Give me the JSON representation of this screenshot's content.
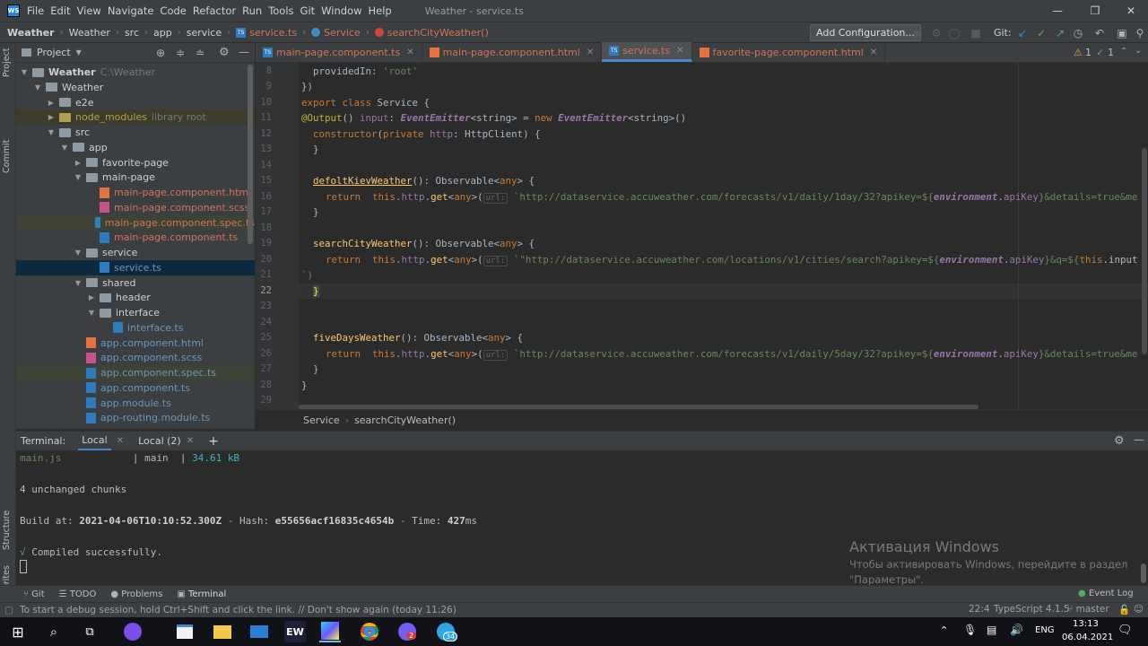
{
  "menu": [
    "File",
    "Edit",
    "View",
    "Navigate",
    "Code",
    "Refactor",
    "Run",
    "Tools",
    "Git",
    "Window",
    "Help"
  ],
  "window_title": "Weather - service.ts",
  "breadcrumb": [
    "Weather",
    "Weather",
    "src",
    "app",
    "service",
    "service.ts",
    "Service",
    "searchCityWeather()"
  ],
  "add_config": "Add Configuration...",
  "git_label": "Git:",
  "project_panel": {
    "title": "Project",
    "tree": [
      {
        "label": "Weather",
        "extra": "C:\\Weather",
        "depth": 0,
        "arrow": "v",
        "type": "folder"
      },
      {
        "label": "Weather",
        "extra": "",
        "depth": 1,
        "arrow": "v",
        "type": "folder"
      },
      {
        "label": "e2e",
        "extra": "",
        "depth": 2,
        "arrow": ">",
        "type": "folder"
      },
      {
        "label": "node_modules",
        "extra": "library root",
        "depth": 2,
        "arrow": ">",
        "type": "folder-yellow"
      },
      {
        "label": "src",
        "extra": "",
        "depth": 2,
        "arrow": "v",
        "type": "folder"
      },
      {
        "label": "app",
        "extra": "",
        "depth": 3,
        "arrow": "v",
        "type": "folder"
      },
      {
        "label": "favorite-page",
        "extra": "",
        "depth": 4,
        "arrow": ">",
        "type": "folder"
      },
      {
        "label": "main-page",
        "extra": "",
        "depth": 4,
        "arrow": "v",
        "type": "folder"
      },
      {
        "label": "main-page.component.html",
        "extra": "",
        "depth": 5,
        "arrow": "",
        "type": "html"
      },
      {
        "label": "main-page.component.scss",
        "extra": "",
        "depth": 5,
        "arrow": "",
        "type": "scss"
      },
      {
        "label": "main-page.component.spec.ts",
        "extra": "",
        "depth": 5,
        "arrow": "",
        "type": "ts"
      },
      {
        "label": "main-page.component.ts",
        "extra": "",
        "depth": 5,
        "arrow": "",
        "type": "ts"
      },
      {
        "label": "service",
        "extra": "",
        "depth": 4,
        "arrow": "v",
        "type": "folder"
      },
      {
        "label": "service.ts",
        "extra": "",
        "depth": 5,
        "arrow": "",
        "type": "ts"
      },
      {
        "label": "shared",
        "extra": "",
        "depth": 4,
        "arrow": "v",
        "type": "folder"
      },
      {
        "label": "header",
        "extra": "",
        "depth": 5,
        "arrow": ">",
        "type": "folder"
      },
      {
        "label": "interface",
        "extra": "",
        "depth": 5,
        "arrow": "v",
        "type": "folder"
      },
      {
        "label": "interface.ts",
        "extra": "",
        "depth": 6,
        "arrow": "",
        "type": "ts"
      },
      {
        "label": "app.component.html",
        "extra": "",
        "depth": 4,
        "arrow": "",
        "type": "html"
      },
      {
        "label": "app.component.scss",
        "extra": "",
        "depth": 4,
        "arrow": "",
        "type": "scss"
      },
      {
        "label": "app.component.spec.ts",
        "extra": "",
        "depth": 4,
        "arrow": "",
        "type": "ts"
      },
      {
        "label": "app.component.ts",
        "extra": "",
        "depth": 4,
        "arrow": "",
        "type": "ts"
      },
      {
        "label": "app.module.ts",
        "extra": "",
        "depth": 4,
        "arrow": "",
        "type": "ts"
      },
      {
        "label": "app-routing.module.ts",
        "extra": "",
        "depth": 4,
        "arrow": "",
        "type": "ts"
      }
    ]
  },
  "left_strip": [
    "Project",
    "Commit",
    "Structure",
    "Favorites"
  ],
  "tabs": [
    {
      "label": "main-page.component.ts",
      "type": "ts",
      "active": false
    },
    {
      "label": "main-page.component.html",
      "type": "html",
      "active": false
    },
    {
      "label": "service.ts",
      "type": "ts",
      "active": true
    },
    {
      "label": "favorite-page.component.html",
      "type": "html",
      "active": false
    }
  ],
  "inspection": {
    "warnings": "1",
    "weak": "1"
  },
  "line_numbers": [
    "8",
    "9",
    "10",
    "11",
    "12",
    "13",
    "14",
    "15",
    "16",
    "17",
    "18",
    "19",
    "20",
    "21",
    "22",
    "23",
    "24",
    "25",
    "26",
    "27",
    "28",
    "29"
  ],
  "code": {
    "l8_a": "providedIn: ",
    "l8_b": "'root'",
    "l9": "})",
    "l10_kw": "export class ",
    "l10_name": "Service {",
    "l11_ann": "@Output",
    "l11_a": "() ",
    "l11_b": "input",
    "l11_c": ": ",
    "l11_d": "EventEmitter",
    "l11_e": "<string> = ",
    "l11_f": "new ",
    "l11_g": "EventEmitter",
    "l11_h": "<string>()",
    "l12_a": "constructor",
    "l12_b": "(",
    "l12_c": "private ",
    "l12_d": "http",
    "l12_e": ": HttpClient) {",
    "l13": "}",
    "l15_a": "defoltKievWeather",
    "l15_b": "(): Observable<",
    "l15_c": "any",
    "l15_d": "> {",
    "l16_a": "return  ",
    "l16_b": "this",
    "l16_c": ".",
    "l16_d": "http",
    "l16_e": ".",
    "l16_f": "get",
    "l16_g": "<",
    "l16_h": "any",
    "l16_i": ">(",
    "url_hint": "url:",
    "l16_j": "`http://dataservice.accuweather.com/forecasts/v1/daily/1day/32?apikey=${",
    "l16_k": "environment",
    "l16_l": ".",
    "l16_m": "apiKey",
    "l16_n": "}&details=true&me",
    "l17": "}",
    "l19_a": "searchCityWeather",
    "l19_b": "(): Observable<",
    "l19_c": "any",
    "l19_d": "> {",
    "l20_a": "return  ",
    "l20_b": "this",
    "l20_c": ".",
    "l20_d": "http",
    "l20_e": ".",
    "l20_f": "get",
    "l20_g": "<",
    "l20_h": "any",
    "l20_i": ">(",
    "l20_j": "`\"http://dataservice.accuweather.com/locations/v1/cities/search?apikey=${",
    "l20_k": "environment",
    "l20_l": ".",
    "l20_m": "apiKey",
    "l20_n": "}&q=${",
    "l20_o": "this",
    "l20_p": ".input",
    "l21": "`)",
    "l22": "}",
    "l25_a": "fiveDaysWeather",
    "l25_b": "(): Observable<",
    "l25_c": "any",
    "l25_d": "> {",
    "l26_a": "return  ",
    "l26_b": "this",
    "l26_c": ".",
    "l26_d": "http",
    "l26_e": ".",
    "l26_f": "get",
    "l26_g": "<",
    "l26_h": "any",
    "l26_i": ">(",
    "l26_j": "`http://dataservice.accuweather.com/forecasts/v1/daily/5day/32?apikey=${",
    "l26_k": "environment",
    "l26_l": ".",
    "l26_m": "apiKey",
    "l26_n": "}&details=true&me",
    "l27": "}",
    "l28": "}"
  },
  "editor_breadcrumb": [
    "Service",
    "searchCityWeather()"
  ],
  "terminal": {
    "label": "Terminal:",
    "tabs": [
      "Local",
      "Local (2)"
    ],
    "lines": {
      "main_js": "main.js",
      "main_sep": "| main  |",
      "main_size": "34.61 kB",
      "unchanged": "4 unchanged chunks",
      "build_a": "Build at: ",
      "build_b": "2021-04-06T10:10:52.300Z",
      "build_c": " - Hash: ",
      "build_d": "e55656acf16835c4654b",
      "build_e": " - Time: ",
      "build_f": "427",
      "build_g": "ms",
      "ok_mark": "√",
      "ok_text": " Compiled successfully."
    }
  },
  "activation": {
    "title": "Активация Windows",
    "line1": "Чтобы активировать Windows, перейдите в раздел",
    "line2": "\"Параметры\"."
  },
  "tool_windows": [
    "Git",
    "TODO",
    "Problems",
    "Terminal"
  ],
  "event_log": "Event Log",
  "status": {
    "message": "To start a debug session, hold Ctrl+Shift and click the link. // Don't show again (today 11:26)",
    "position": "22:4",
    "typescript": "TypeScript 4.1.5",
    "branch": "master"
  },
  "taskbar": {
    "lang": "ENG",
    "time": "13:13",
    "date": "06.04.2021",
    "badge1": "2",
    "badge2": "34",
    "ew": "EW"
  },
  "colors": {
    "accent": "#4a88c7",
    "keyword": "#cc7832",
    "string": "#6a8759",
    "function": "#ffc66d",
    "field": "#9876aa"
  }
}
